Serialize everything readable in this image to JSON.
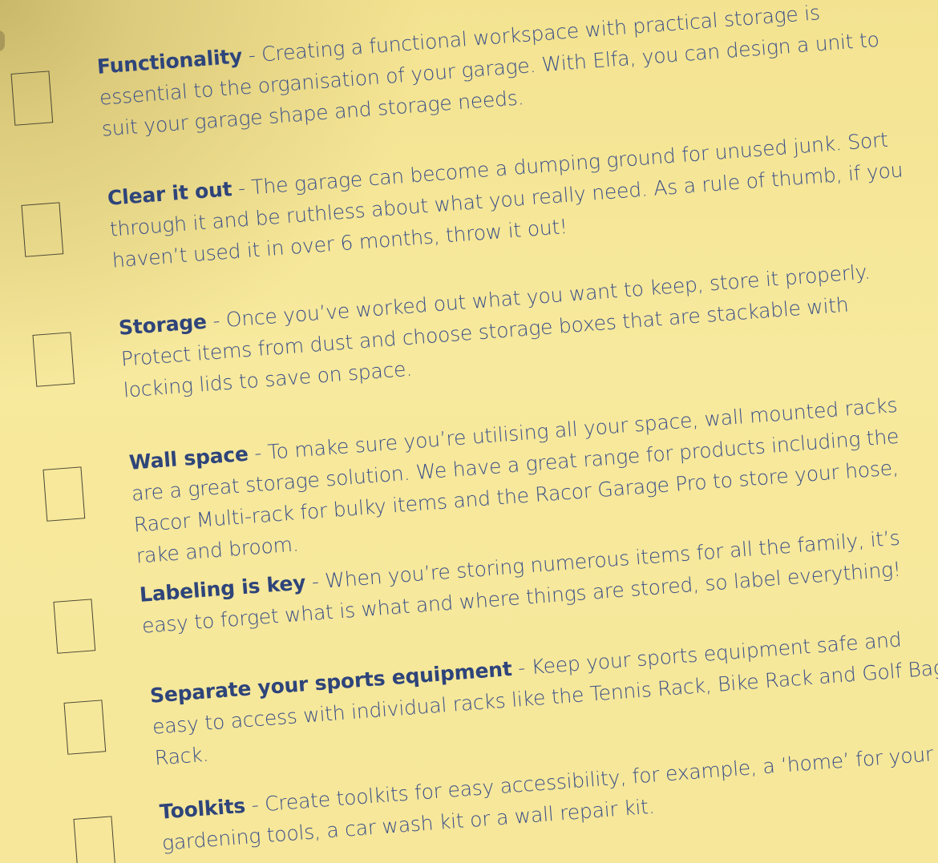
{
  "items": [
    {
      "title": "Functionality",
      "body": " - Creating a functional workspace with practical storage is essential to the organisation of your garage. With Elfa, you can design a unit to suit your garage shape and storage needs."
    },
    {
      "title": "Clear it out",
      "body": " - The garage can become a dumping ground for unused junk. Sort through it and be ruthless about what you really need. As a rule of thumb, if you haven’t used it in over 6 months, throw it out!"
    },
    {
      "title": "Storage",
      "body": " - Once you’ve worked out what you want to keep, store it properly. Protect items from dust and choose storage boxes that are stackable with locking lids to save on space."
    },
    {
      "title": "Wall space",
      "body": " - To make sure you’re utilising all your space, wall mounted racks are a great storage solution. We have a great range for products including the Racor Multi-rack for bulky items and the Racor Garage Pro to store your hose, rake and broom."
    },
    {
      "title": "Labeling is key",
      "body": " - When you’re storing numerous items for all the family, it’s easy to forget what is what and where things are stored, so label everything!"
    },
    {
      "title": "Separate your sports equipment",
      "body": " - Keep your sports equipment safe and easy to access with individual racks like the Tennis Rack, Bike Rack and Golf Bag Rack."
    },
    {
      "title": "Toolkits",
      "body": " - Create toolkits for easy accessibility, for example, a ‘home’ for your gardening tools, a car wash kit or a wall repair kit."
    }
  ]
}
